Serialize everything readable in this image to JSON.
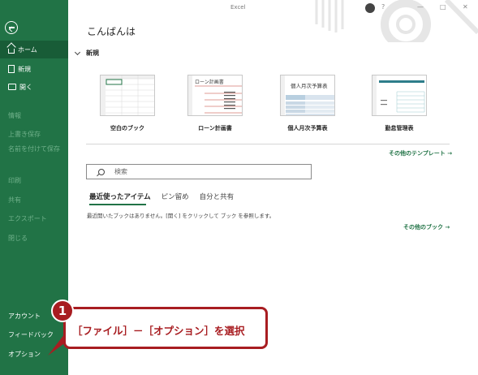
{
  "app": {
    "title": "Excel"
  },
  "sidebar": {
    "items": [
      {
        "label": "ホーム"
      },
      {
        "label": "新規"
      },
      {
        "label": "開く"
      },
      {
        "label": "情報"
      },
      {
        "label": "上書き保存"
      },
      {
        "label": "名前を付けて保存"
      },
      {
        "label": "印刷"
      },
      {
        "label": "共有"
      },
      {
        "label": "エクスポート"
      },
      {
        "label": "閉じる"
      }
    ],
    "bottom": [
      {
        "label": "アカウント"
      },
      {
        "label": "フィードバック"
      },
      {
        "label": "オプション"
      }
    ]
  },
  "main": {
    "greeting": "こんばんは",
    "new_section": "新規",
    "templates": [
      {
        "name": "空白のブック"
      },
      {
        "name": "ローン計画書",
        "thumb_title": "ローン計画書"
      },
      {
        "name": "個人月次予算表",
        "thumb_title": "個人月次予算表"
      },
      {
        "name": "勤怠管理表"
      }
    ],
    "more_templates": "その他のテンプレート →",
    "search_placeholder": "検索",
    "tabs": [
      {
        "label": "最近使ったアイテム"
      },
      {
        "label": "ピン留め"
      },
      {
        "label": "自分と共有"
      }
    ],
    "recent_message": "最近開いたブックはありません。[開く] をクリックして ブック を参照します。",
    "more_books": "その他のブック →"
  },
  "annotation": {
    "number": "1",
    "text": "［ファイル］－［オプション］を選択",
    "color": "#a81d21"
  },
  "colors": {
    "brand": "#217346",
    "brand_dark": "#185c37"
  }
}
